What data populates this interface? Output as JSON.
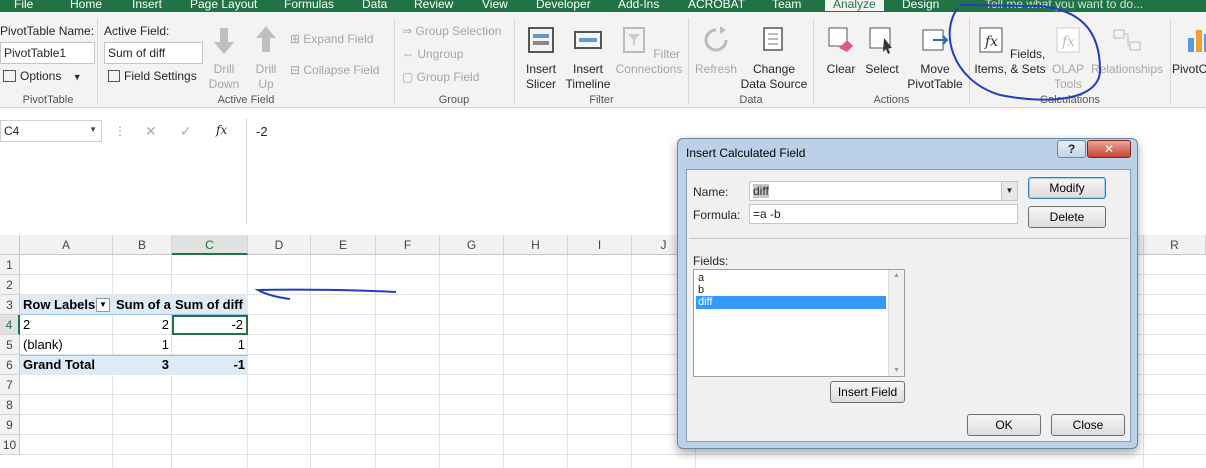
{
  "ribbon_tabs": [
    "File",
    "Home",
    "Insert",
    "Page Layout",
    "Formulas",
    "Data",
    "Review",
    "View",
    "Developer",
    "Add-Ins",
    "ACROBAT",
    "Team",
    "Analyze",
    "Design"
  ],
  "tell_me": "Tell me what you want to do...",
  "pivottable_group": {
    "name_label": "PivotTable Name:",
    "name_value": "PivotTable1",
    "options_label": "Options",
    "group_label": "PivotTable"
  },
  "active_field_group": {
    "label": "Active Field:",
    "value": "Sum of diff",
    "field_settings": "Field Settings",
    "drill_down": "Drill Down",
    "drill_up": "Drill Up",
    "expand_field": "Expand Field",
    "collapse_field": "Collapse Field",
    "group_label": "Active Field"
  },
  "group_group": {
    "group_selection": "Group Selection",
    "ungroup": "Ungroup",
    "group_field": "Group Field",
    "group_label": "Group"
  },
  "filter_group": {
    "insert_slicer": "Insert Slicer",
    "insert_timeline": "Insert Timeline",
    "filter_connections": "Filter Connections",
    "group_label": "Filter"
  },
  "data_group": {
    "refresh": "Refresh",
    "change_data_source": "Change Data Source",
    "group_label": "Data"
  },
  "actions_group": {
    "clear": "Clear",
    "select": "Select",
    "move_pivottable": "Move PivotTable",
    "group_label": "Actions"
  },
  "calculations_group": {
    "fields_items_sets": "Fields, Items, & Sets",
    "olap_tools": "OLAP Tools",
    "relationships": "Relationships",
    "group_label": "Calculations"
  },
  "pivot_chart_partial": "PivotC",
  "formula_bar": {
    "name_box": "C4",
    "fx": "fx",
    "value": "-2"
  },
  "columns": [
    "A",
    "B",
    "C",
    "D",
    "E",
    "F",
    "G",
    "H",
    "I",
    "J",
    "R"
  ],
  "rows": [
    "1",
    "2",
    "3",
    "4",
    "5",
    "6",
    "7",
    "8",
    "9",
    "10"
  ],
  "pivot": {
    "headers": [
      "Row Labels",
      "Sum of a",
      "Sum of diff"
    ],
    "rows": [
      {
        "label": "2",
        "a": "2",
        "diff": "-2"
      },
      {
        "label": "(blank)",
        "a": "1",
        "diff": "1"
      }
    ],
    "total": {
      "label": "Grand Total",
      "a": "3",
      "diff": "-1"
    }
  },
  "dialog": {
    "title": "Insert Calculated Field",
    "help": "?",
    "close_x": "✕",
    "name_label": "Name:",
    "name_value": "diff",
    "formula_label": "Formula:",
    "formula_value": "=a -b",
    "modify": "Modify",
    "delete": "Delete",
    "fields_label": "Fields:",
    "fields": [
      "a",
      "b",
      "diff"
    ],
    "selected_field": "diff",
    "insert_field": "Insert Field",
    "ok": "OK",
    "close": "Close"
  },
  "colors": {
    "excel_green": "#217346",
    "annotation_blue": "#1f3fbf",
    "selection_blue": "#3399ff",
    "pivot_header_fill": "#ddebf7"
  }
}
